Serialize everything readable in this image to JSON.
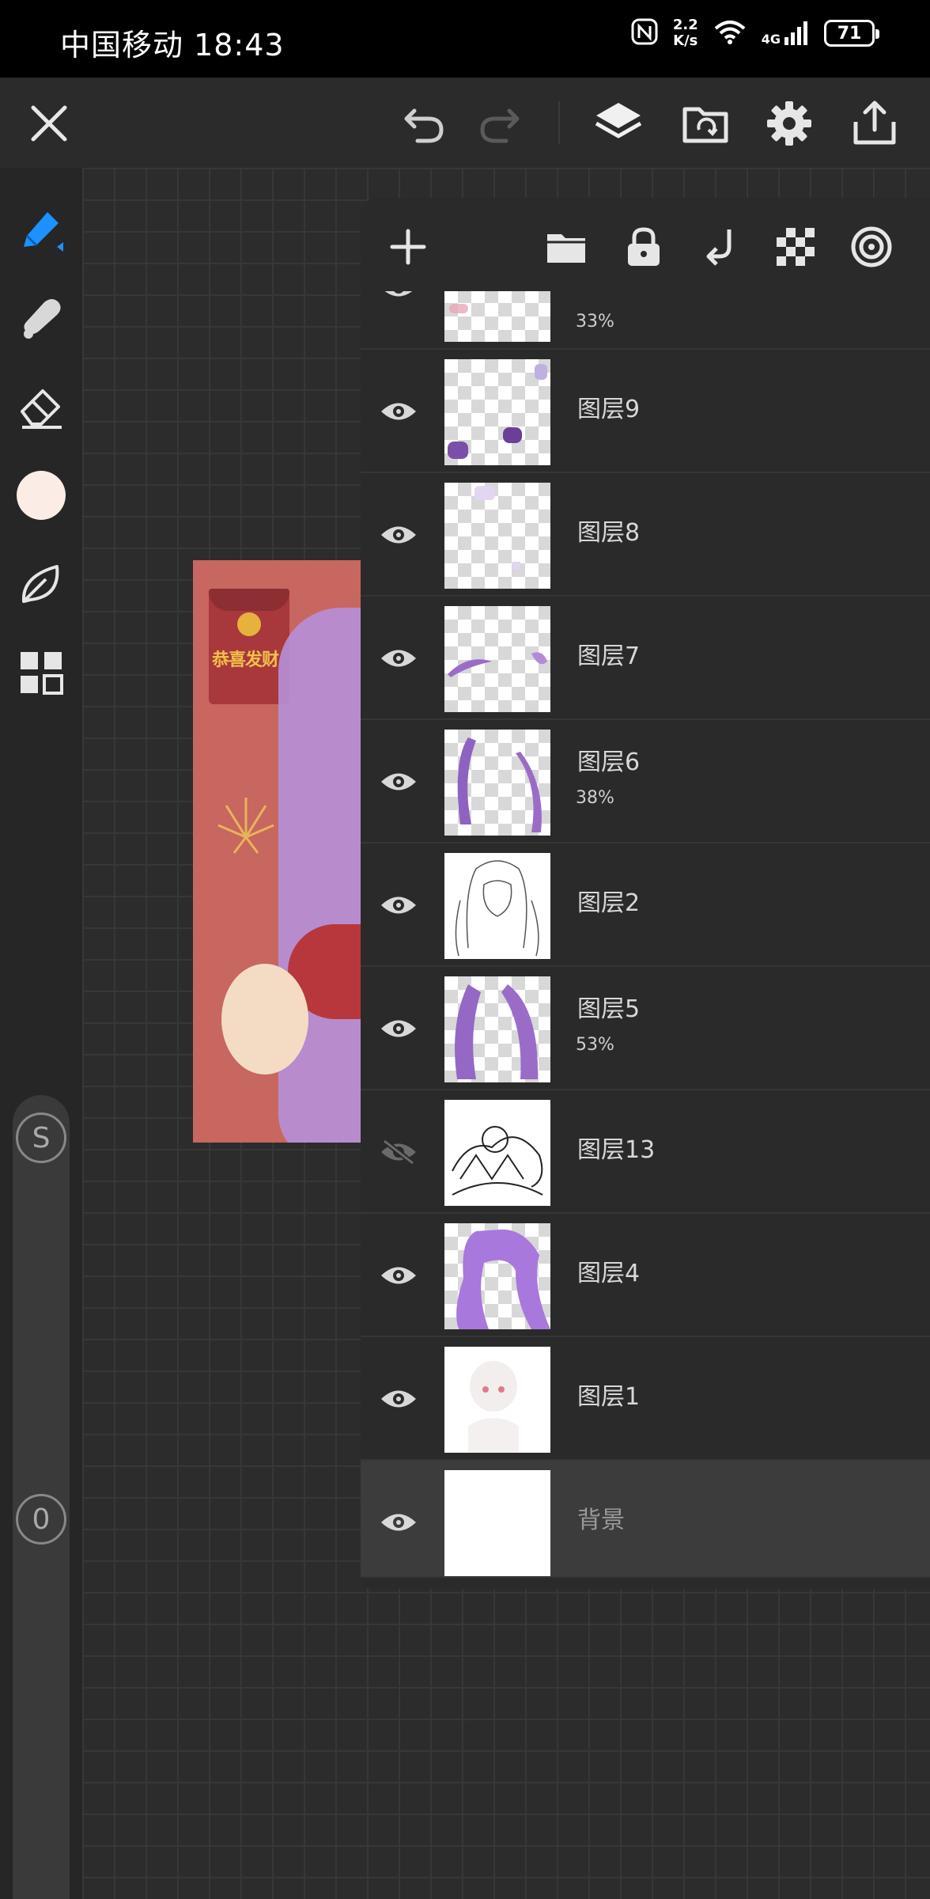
{
  "status_bar": {
    "carrier_time": "中国移动 18:43",
    "net_speed_value": "2.2",
    "net_speed_unit": "K/s",
    "network": "4G",
    "battery": "71"
  },
  "toolbar": {
    "icons": [
      "close-icon",
      "undo-icon",
      "redo-icon",
      "layers-icon",
      "import-icon",
      "settings-icon",
      "share-icon"
    ]
  },
  "left_tools": {
    "icons": [
      "pen-icon",
      "smudge-icon",
      "eraser-icon",
      "color-swatch",
      "leaf-icon",
      "grid-icon"
    ],
    "current_color": "#fbece6",
    "size_badge": "S",
    "opacity_badge": "0"
  },
  "artwork": {
    "envelope_text": "恭喜发财"
  },
  "layers_panel": {
    "toolbar_icons": [
      "add-icon",
      "folder-icon",
      "lock-icon",
      "merge-down-icon",
      "checker-icon",
      "target-icon"
    ],
    "layers": [
      {
        "name": "",
        "opacity": "33%",
        "visible": true
      },
      {
        "name": "图层9",
        "opacity": "",
        "visible": true
      },
      {
        "name": "图层8",
        "opacity": "",
        "visible": true
      },
      {
        "name": "图层7",
        "opacity": "",
        "visible": true
      },
      {
        "name": "图层6",
        "opacity": "38%",
        "visible": true
      },
      {
        "name": "图层2",
        "opacity": "",
        "visible": true
      },
      {
        "name": "图层5",
        "opacity": "53%",
        "visible": true
      },
      {
        "name": "图层13",
        "opacity": "",
        "visible": false
      },
      {
        "name": "图层4",
        "opacity": "",
        "visible": true
      },
      {
        "name": "图层1",
        "opacity": "",
        "visible": true
      },
      {
        "name": "背景",
        "opacity": "",
        "visible": true,
        "selected": true
      }
    ]
  },
  "colors": {
    "accent": "#1e90ff",
    "panel": "#2a2a2a",
    "canvas_bg": "#c86660"
  }
}
